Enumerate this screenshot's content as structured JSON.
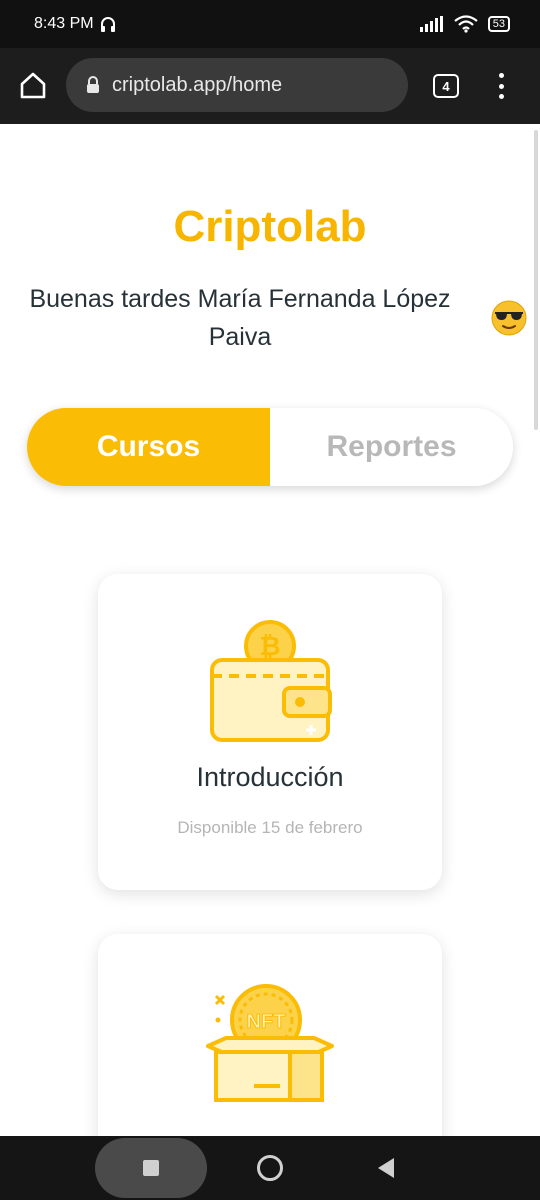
{
  "status_bar": {
    "time": "8:43 PM",
    "battery": "53",
    "icons": [
      "headphones-icon",
      "signal-icon",
      "wifi-icon",
      "battery-icon"
    ]
  },
  "browser": {
    "url": "criptolab.app/home",
    "tab_count": "4",
    "icons": [
      "home-icon",
      "lock-icon",
      "tabs-icon",
      "more-vert-icon"
    ]
  },
  "page": {
    "title": "Criptolab",
    "greeting": "Buenas tardes María Fernanda López Paiva",
    "emoji": "smiling-face-with-sunglasses"
  },
  "toggle": {
    "active": "Cursos",
    "inactive": "Reportes"
  },
  "cards": [
    {
      "title": "Introducción",
      "subtitle": "Disponible 15 de febrero",
      "icon": "wallet-bitcoin-icon"
    },
    {
      "title": "",
      "subtitle": "",
      "icon": "nft-box-icon"
    }
  ],
  "colors": {
    "accent": "#fbbc05",
    "title": "#f7b500",
    "text": "#263238",
    "muted": "#b5b5b5"
  },
  "nav_bar": {
    "icons": [
      "recents-button",
      "home-button",
      "back-button"
    ]
  }
}
